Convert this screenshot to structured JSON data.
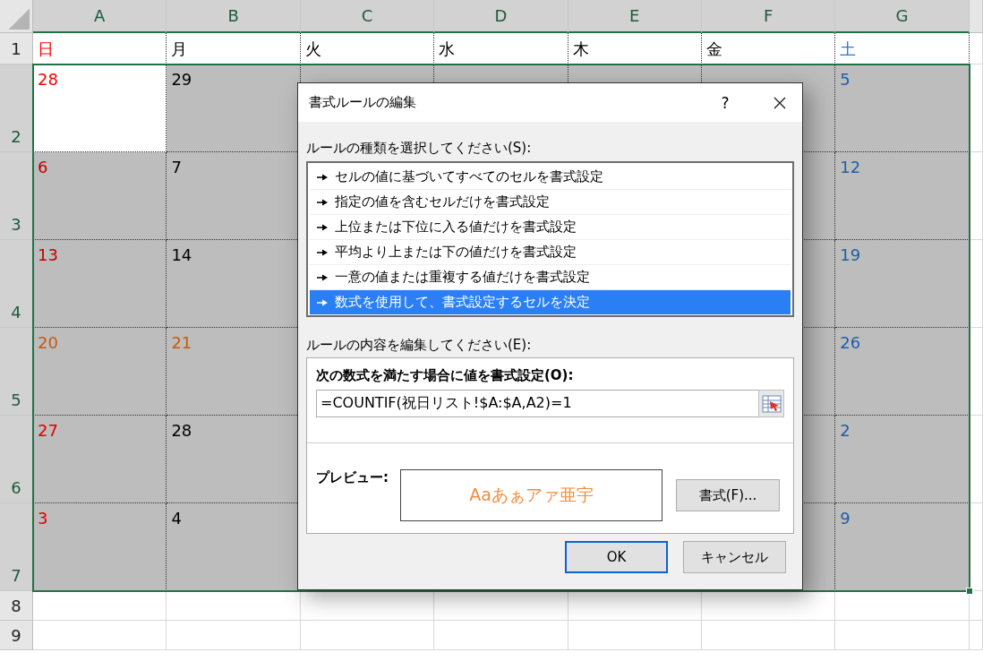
{
  "sheet": {
    "columns": [
      {
        "label": "A",
        "selected": true
      },
      {
        "label": "B",
        "selected": true
      },
      {
        "label": "C",
        "selected": true
      },
      {
        "label": "D",
        "selected": true
      },
      {
        "label": "E",
        "selected": true
      },
      {
        "label": "F",
        "selected": true
      },
      {
        "label": "G",
        "selected": true
      }
    ],
    "rows": [
      {
        "number": "1",
        "selected": false,
        "cells": [
          {
            "text": "日",
            "color": "#ff0000",
            "shaded": false
          },
          {
            "text": "月",
            "color": "#000000",
            "shaded": false
          },
          {
            "text": "火",
            "color": "#000000",
            "shaded": false
          },
          {
            "text": "水",
            "color": "#000000",
            "shaded": false
          },
          {
            "text": "木",
            "color": "#000000",
            "shaded": false
          },
          {
            "text": "金",
            "color": "#000000",
            "shaded": false
          },
          {
            "text": "土",
            "color": "#2e75d6",
            "shaded": false
          }
        ]
      },
      {
        "number": "2",
        "selected": true,
        "cells": [
          {
            "text": "28",
            "color": "#ff0000",
            "shaded": false
          },
          {
            "text": "29",
            "color": "#000000",
            "shaded": true
          },
          {
            "shaded": true
          },
          {
            "shaded": true
          },
          {
            "shaded": true
          },
          {
            "shaded": true
          },
          {
            "text": "5",
            "color": "#1f5fa8",
            "shaded": true
          }
        ]
      },
      {
        "number": "3",
        "selected": true,
        "cells": [
          {
            "text": "6",
            "color": "#c00000",
            "shaded": true
          },
          {
            "text": "7",
            "color": "#000000",
            "shaded": true
          },
          null,
          null,
          null,
          {
            "shaded": true
          },
          {
            "text": "12",
            "color": "#1f5fa8",
            "shaded": true
          }
        ]
      },
      {
        "number": "4",
        "selected": true,
        "cells": [
          {
            "text": "13",
            "color": "#c00000",
            "shaded": true
          },
          {
            "text": "14",
            "color": "#000000",
            "shaded": true
          },
          null,
          null,
          null,
          {
            "shaded": true
          },
          {
            "text": "19",
            "color": "#1f5fa8",
            "shaded": true
          }
        ]
      },
      {
        "number": "5",
        "selected": true,
        "cells": [
          {
            "text": "20",
            "color": "#c55a11",
            "shaded": true
          },
          {
            "text": "21",
            "color": "#c55a11",
            "shaded": true
          },
          null,
          null,
          null,
          {
            "shaded": true
          },
          {
            "text": "26",
            "color": "#1f5fa8",
            "shaded": true
          }
        ]
      },
      {
        "number": "6",
        "selected": true,
        "cells": [
          {
            "text": "27",
            "color": "#e00000",
            "shaded": true
          },
          {
            "text": "28",
            "color": "#000000",
            "shaded": true
          },
          null,
          null,
          null,
          {
            "shaded": true
          },
          {
            "text": "2",
            "color": "#1f5fa8",
            "shaded": true
          }
        ]
      },
      {
        "number": "7",
        "selected": true,
        "cells": [
          {
            "text": "3",
            "color": "#e00000",
            "shaded": true
          },
          {
            "text": "4",
            "color": "#000000",
            "shaded": true
          },
          null,
          null,
          null,
          {
            "shaded": true
          },
          {
            "text": "9",
            "color": "#1f5fa8",
            "shaded": true
          }
        ]
      },
      {
        "number": "8",
        "selected": false,
        "cells": []
      },
      {
        "number": "9",
        "selected": false,
        "cells": []
      }
    ]
  },
  "dialog": {
    "title": "書式ルールの編集",
    "help": "?",
    "rule_type_label": "ルールの種類を選択してください(S):",
    "rule_types": [
      {
        "label": "セルの値に基づいてすべてのセルを書式設定",
        "selected": false
      },
      {
        "label": "指定の値を含むセルだけを書式設定",
        "selected": false
      },
      {
        "label": "上位または下位に入る値だけを書式設定",
        "selected": false
      },
      {
        "label": "平均より上または下の値だけを書式設定",
        "selected": false
      },
      {
        "label": "一意の値または重複する値だけを書式設定",
        "selected": false
      },
      {
        "label": "数式を使用して、書式設定するセルを決定",
        "selected": true
      }
    ],
    "edit_label": "ルールの内容を編集してください(E):",
    "formula_label": "次の数式を満たす場合に値を書式設定(O):",
    "formula": "=COUNTIF(祝日リスト!$A:$A,A2)=1",
    "preview_label": "プレビュー:",
    "preview_text": "Aaあぁアァ亜宇",
    "format_button": "書式(F)...",
    "buttons": [
      {
        "label": "OK",
        "kind": "default"
      },
      {
        "label": "キャンセル",
        "kind": "normal"
      }
    ]
  }
}
